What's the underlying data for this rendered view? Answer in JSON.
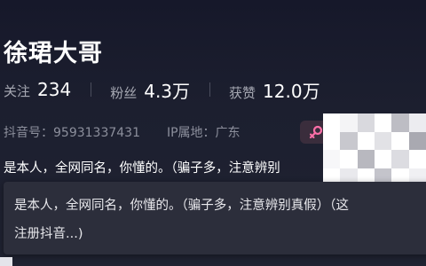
{
  "profile": {
    "name": "徐珺大哥",
    "stats": [
      {
        "label": "关注",
        "value": "234"
      },
      {
        "label": "粉丝",
        "value": "4.3万"
      },
      {
        "label": "获赞",
        "value": "12.0万"
      }
    ],
    "douyin_id": "抖音号：95931337431",
    "ip_location": "IP属地：广东",
    "gender_icon": "female-icon",
    "bio_short": "是本人，全网同名，你懂的。（骗子多，注意辨别",
    "bio_full_line1": "是本人，全网同名，你懂的。（骗子多，注意辨别真假）（这",
    "bio_full_line2": "注册抖音...)"
  },
  "colors": {
    "background": "#1b1d2a",
    "popup": "#2c2e3b",
    "muted_text": "#8c8f9c",
    "gender_pink": "#ff6fa8"
  }
}
